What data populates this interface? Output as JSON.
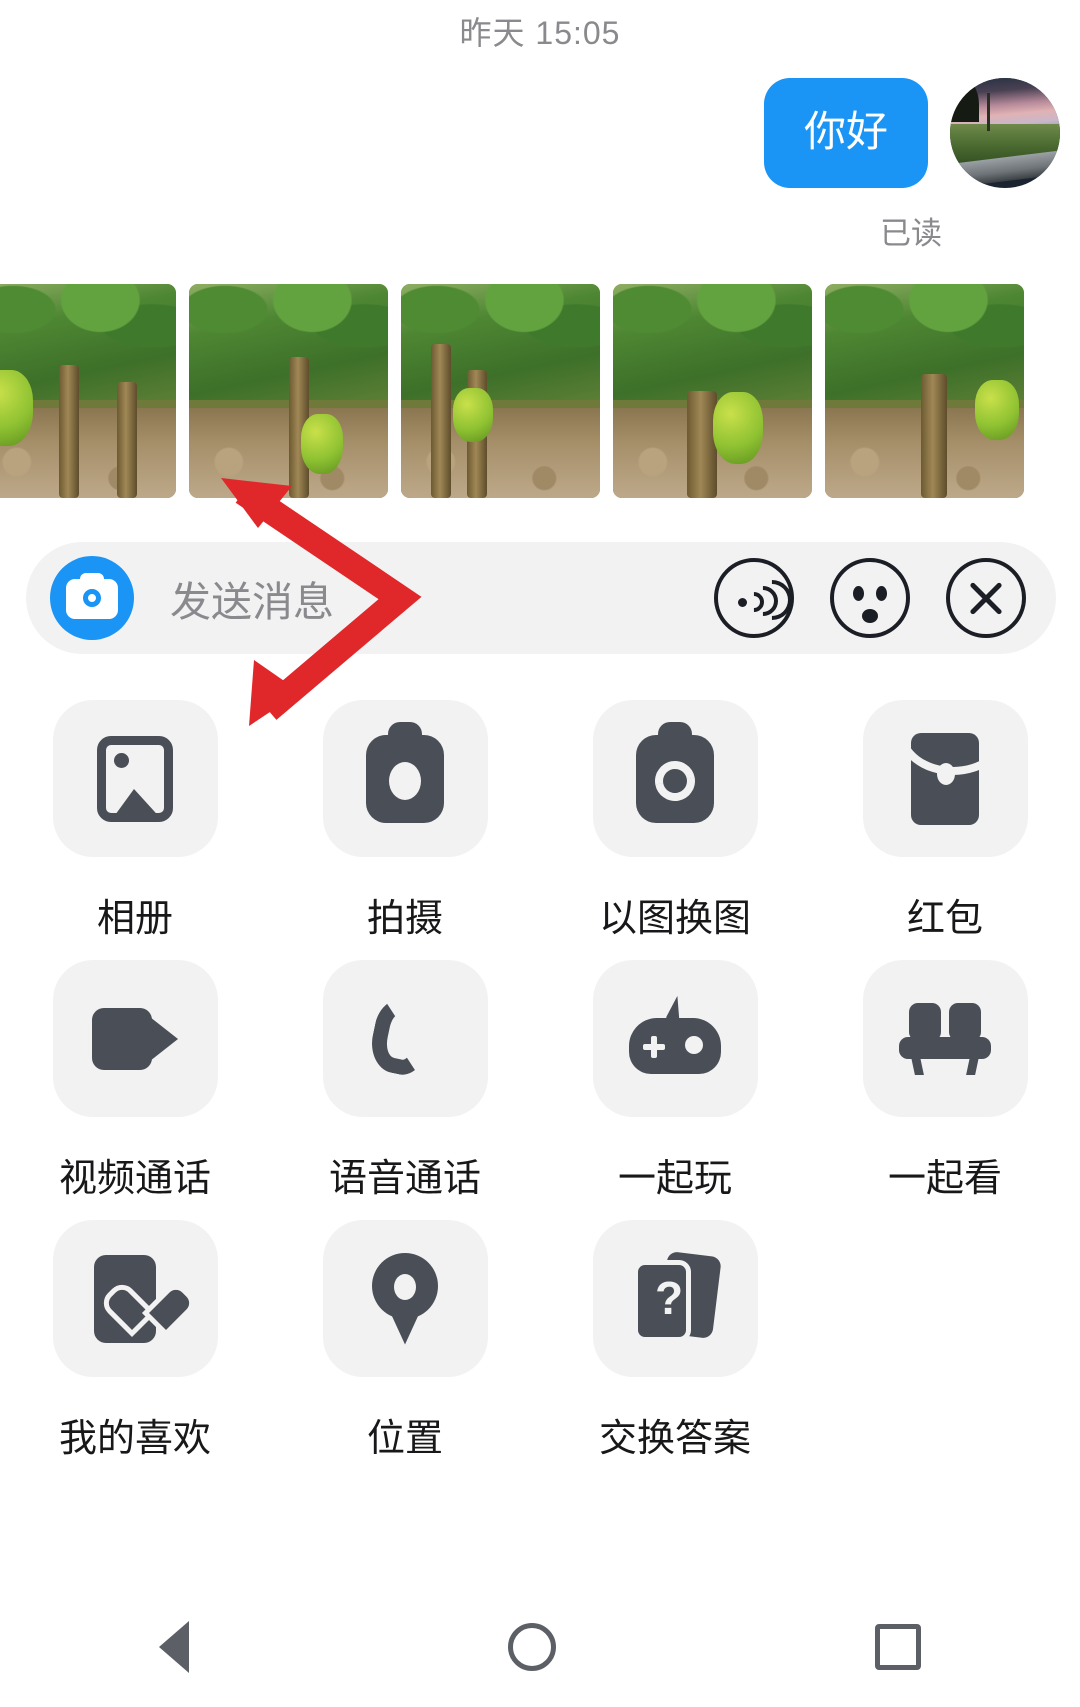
{
  "conversation": {
    "timestamp": "昨天 15:05",
    "message": {
      "text": "你好",
      "status": "已读",
      "bubble_color": "#1a94f5"
    },
    "avatar": {
      "icon": "avatar-photo-sunset-road"
    }
  },
  "photo_strip": {
    "items": [
      {
        "caption": "banana-plantation-1"
      },
      {
        "caption": "banana-plantation-2"
      },
      {
        "caption": "banana-plantation-3"
      },
      {
        "caption": "banana-plantation-4"
      },
      {
        "caption": "banana-plantation-5"
      }
    ]
  },
  "input_bar": {
    "camera_icon": "camera-icon",
    "placeholder": "发送消息",
    "icons": [
      {
        "name": "voice-icon",
        "label": "语音"
      },
      {
        "name": "emoji-face-icon",
        "label": "表情"
      },
      {
        "name": "close-icon",
        "label": "关闭"
      }
    ]
  },
  "action_grid": {
    "items": [
      {
        "label": "相册",
        "icon": "photo-icon"
      },
      {
        "label": "拍摄",
        "icon": "camera-icon"
      },
      {
        "label": "以图换图",
        "icon": "image-swap-icon"
      },
      {
        "label": "红包",
        "icon": "red-packet-icon"
      },
      {
        "label": "视频通话",
        "icon": "video-call-icon"
      },
      {
        "label": "语音通话",
        "icon": "phone-call-icon"
      },
      {
        "label": "一起玩",
        "icon": "game-controller-icon"
      },
      {
        "label": "一起看",
        "icon": "sofa-icon"
      },
      {
        "label": "我的喜欢",
        "icon": "favorite-heart-icon"
      },
      {
        "label": "位置",
        "icon": "location-pin-icon"
      },
      {
        "label": "交换答案",
        "icon": "question-cards-icon"
      }
    ]
  },
  "annotation": {
    "color": "#e0272a",
    "icon": "double-headed-arrow"
  },
  "navbar": {
    "back": "back-icon",
    "home": "home-icon",
    "recents": "recents-icon"
  },
  "misc": {
    "question_mark": "?"
  }
}
